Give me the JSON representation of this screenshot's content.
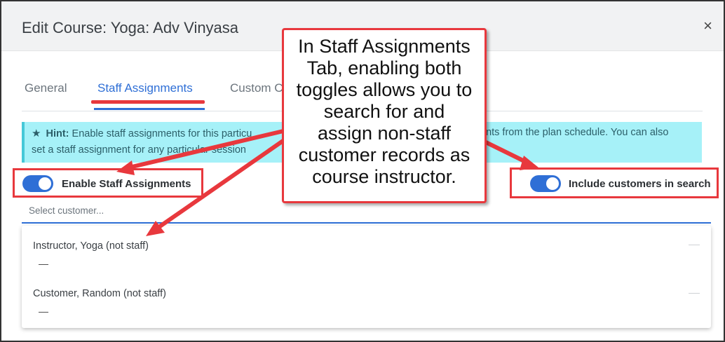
{
  "dialog": {
    "title": "Edit Course: Yoga: Adv Vinyasa",
    "close_glyph": "×"
  },
  "tabs": [
    {
      "label": "General",
      "active": false
    },
    {
      "label": "Staff Assignments",
      "active": true
    },
    {
      "label": "Custom C",
      "active": false
    }
  ],
  "hint": {
    "label": "Hint:",
    "line1_left": "Enable staff assignments for this particu",
    "line1_right": "ents from the plan schedule. You can also",
    "line2": "set a staff assignment for any particular session"
  },
  "toggles": {
    "staff": {
      "label": "Enable Staff Assignments",
      "on": true
    },
    "customers": {
      "label": "Include customers in search",
      "on": true
    }
  },
  "search": {
    "placeholder": "Select customer..."
  },
  "results": [
    {
      "name": "Instructor, Yoga (not staff)",
      "detail": "—"
    },
    {
      "name": "Customer, Random (not staff)",
      "detail": "—"
    }
  ],
  "callout": {
    "lines": [
      "In Staff Assignments",
      "Tab, enabling both",
      "toggles allows you to",
      "search for and",
      "assign non-staff",
      "customer records as",
      "course instructor."
    ]
  },
  "colors": {
    "accent": "#2f6fd6",
    "annotation": "#e8383d",
    "hint_bg": "#a6f1f8"
  }
}
